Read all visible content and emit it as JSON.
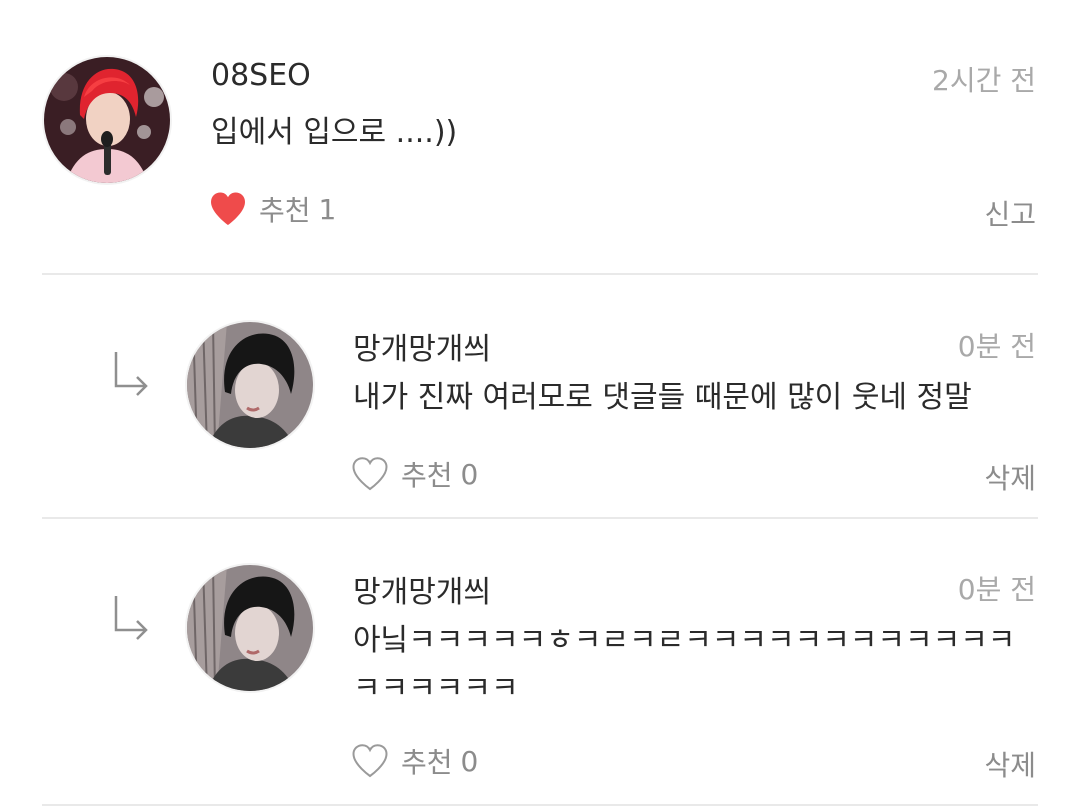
{
  "comments": [
    {
      "author": "08SEO",
      "time": "2시간 전",
      "text": "입에서 입으로 ....))",
      "like_label": "추천",
      "like_count": "1",
      "liked": true,
      "action": "신고",
      "is_reply": false
    },
    {
      "author": "망개망개씌",
      "time": "0분 전",
      "text": "내가 진짜 여러모로 댓글들 때문에 많이 웃네 정말",
      "like_label": "추천",
      "like_count": "0",
      "liked": false,
      "action": "삭제",
      "is_reply": true
    },
    {
      "author": "망개망개씌",
      "time": "0분 전",
      "text": "아닠ㅋㅋㅋㅋㅋㅎㅋㄹㅋㄹㅋㅋㅋㅋㅋㅋㅋㅋㅋㅋㅋㅋㅋㅋㅋㅋㅋㅋ",
      "like_label": "추천",
      "like_count": "0",
      "liked": false,
      "action": "삭제",
      "is_reply": true
    }
  ],
  "icons": {
    "liked_heart": "heart-filled-icon",
    "unliked_heart": "heart-outline-icon",
    "reply": "reply-arrow-icon"
  },
  "colors": {
    "heart": "#ef4b4b",
    "heart_outline": "#9a9a9a",
    "time": "#a9a9a9",
    "meta": "#8c8c8c",
    "divider": "#e9e9e9"
  }
}
